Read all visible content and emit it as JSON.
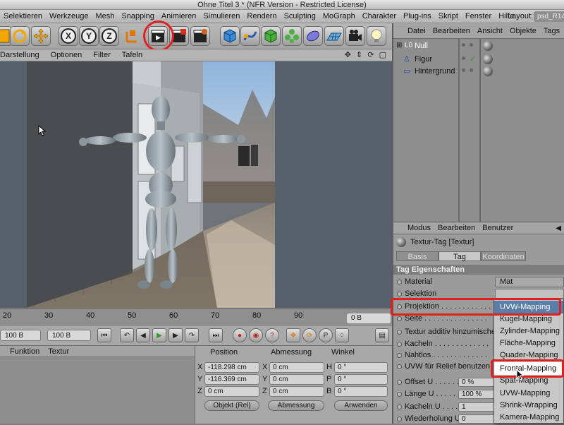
{
  "window": {
    "title": "Ohne Titel 3 * (NFR Version - Restricted License)"
  },
  "menubar": {
    "items": [
      "Selektieren",
      "Werkzeuge",
      "Mesh",
      "Snapping",
      "Animieren",
      "Simulieren",
      "Rendern",
      "Sculpting",
      "MoGraph",
      "Charakter",
      "Plug-ins",
      "Skript",
      "Fenster",
      "Hilfe"
    ],
    "layout_label": "Layout:",
    "layout_value": "psd_R14"
  },
  "toolbar": {
    "axis_x": "X",
    "axis_y": "Y",
    "axis_z": "Z"
  },
  "viewport": {
    "menu": [
      "Darstellung",
      "Optionen",
      "Filter",
      "Tafeln"
    ],
    "nav_icons": "✥ ⇕ ⟳ ▢"
  },
  "timeline": {
    "ticks": [
      "20",
      "30",
      "40",
      "50",
      "60",
      "70",
      "80",
      "90"
    ],
    "frame": "0 B"
  },
  "transport": {
    "field_start": "100 B",
    "field_end": "100 B"
  },
  "material_bar": {
    "menu": [
      "Funktion",
      "Textur"
    ]
  },
  "coords": {
    "headers": {
      "position": "Position",
      "size": "Abmessung",
      "rotation": "Winkel"
    },
    "rows": [
      {
        "axis": "X",
        "pos": "-118.298 cm",
        "size_axis": "X",
        "size": "0 cm",
        "rot_axis": "H",
        "rot": "0 °"
      },
      {
        "axis": "Y",
        "pos": "-116.369 cm",
        "size_axis": "Y",
        "size": "0 cm",
        "rot_axis": "P",
        "rot": "0 °"
      },
      {
        "axis": "Z",
        "pos": "0 cm",
        "size_axis": "Z",
        "size": "0 cm",
        "rot_axis": "B",
        "rot": "0 °"
      }
    ],
    "mode_select": "Objekt (Rel)",
    "size_select": "Abmessung",
    "apply": "Anwenden"
  },
  "objects": {
    "menu": [
      "Datei",
      "Bearbeiten",
      "Ansicht",
      "Objekte",
      "Tags"
    ],
    "items": [
      "Null",
      "Figur",
      "Hintergrund"
    ]
  },
  "attributes": {
    "menu": [
      "Modus",
      "Bearbeiten",
      "Benutzer"
    ],
    "title": "Textur-Tag [Textur]",
    "tabs": [
      "Basis",
      "Tag",
      "Koordinaten"
    ],
    "active_tab": "Tag",
    "section": "Tag Eigenschaften",
    "props": [
      {
        "label": "Material",
        "value": "Mat"
      },
      {
        "label": "Selektion",
        "value": ""
      },
      {
        "label": "Projektion . . . . . . . . . . . .",
        "value": ""
      },
      {
        "label": "Seite . . . . . . . . . . . . . . .",
        "value": ""
      },
      {
        "label": "Textur additiv hinzumischen",
        "value": ""
      },
      {
        "label": "Kacheln . . . . . . . . . . . . .",
        "value": ""
      },
      {
        "label": "Nahtlos . . . . . . . . . . . . .",
        "value": ""
      },
      {
        "label": "UVW für Relief benutzen",
        "value": ""
      },
      {
        "label": "Offset U . . . . . . .",
        "value": "0 %"
      },
      {
        "label": "Länge U . . . . . . .",
        "value": "100 %"
      },
      {
        "label": "Kacheln U . . . . . .",
        "value": "1"
      },
      {
        "label": "Wiederholung U",
        "value": "0"
      }
    ]
  },
  "projection_dropdown": {
    "options": [
      "UVW-Mapping",
      "Kugel-Mapping",
      "Zylinder-Mapping",
      "Fläche-Mapping",
      "Quader-Mapping",
      "Frontal-Mapping",
      "Spat-Mapping",
      "UVW-Mapping",
      "Shrink-Wrapping",
      "Kamera-Mapping"
    ],
    "current": "UVW-Mapping",
    "hover": "Frontal-Mapping"
  },
  "colors": {
    "highlight": "#e02020",
    "selection": "#5a7ea8"
  }
}
